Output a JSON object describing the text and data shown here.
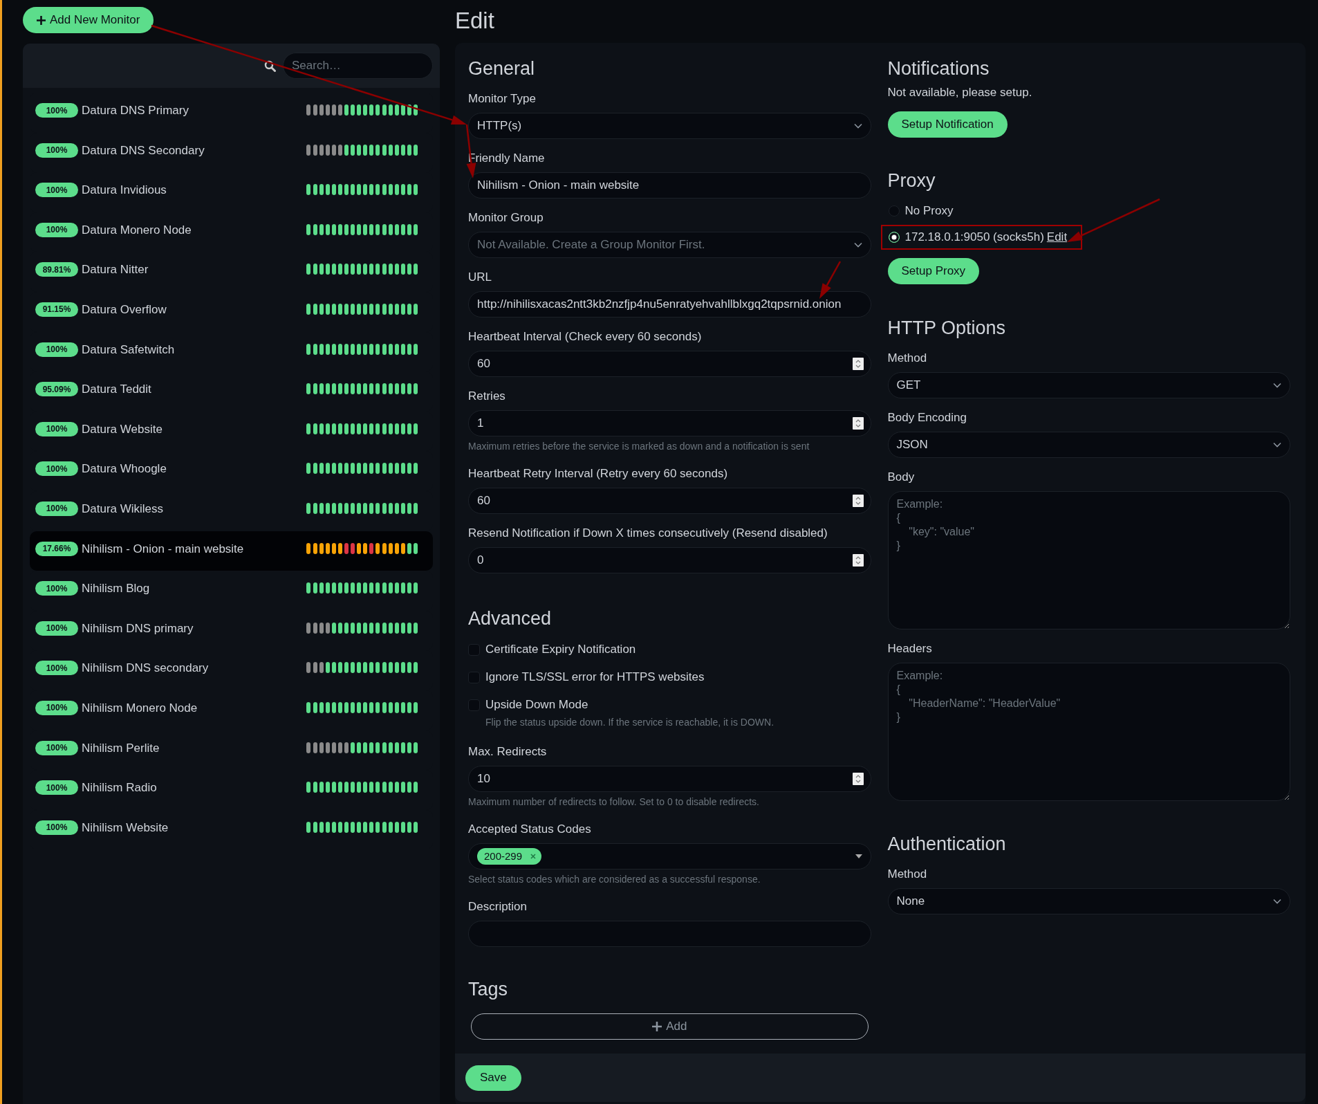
{
  "add_monitor_button": "Add New Monitor",
  "search": {
    "placeholder": "Search…"
  },
  "monitors": [
    {
      "uptime": "100%",
      "name": "Datura DNS Primary",
      "selected": false,
      "beats": [
        {
          "kind": "empty"
        },
        {
          "kind": "empty"
        },
        {
          "kind": "empty"
        },
        {
          "kind": "empty"
        },
        {
          "kind": "empty"
        },
        {
          "kind": "empty"
        },
        {
          "kind": "up"
        },
        {
          "kind": "up"
        },
        {
          "kind": "up"
        },
        {
          "kind": "up"
        },
        {
          "kind": "up"
        },
        {
          "kind": "up"
        },
        {
          "kind": "up"
        },
        {
          "kind": "up"
        },
        {
          "kind": "up"
        },
        {
          "kind": "up"
        },
        {
          "kind": "up"
        },
        {
          "kind": "up"
        }
      ]
    },
    {
      "uptime": "100%",
      "name": "Datura DNS Secondary",
      "selected": false,
      "beats": [
        {
          "kind": "empty"
        },
        {
          "kind": "empty"
        },
        {
          "kind": "empty"
        },
        {
          "kind": "empty"
        },
        {
          "kind": "empty"
        },
        {
          "kind": "empty"
        },
        {
          "kind": "up"
        },
        {
          "kind": "up"
        },
        {
          "kind": "up"
        },
        {
          "kind": "up"
        },
        {
          "kind": "up"
        },
        {
          "kind": "up"
        },
        {
          "kind": "up"
        },
        {
          "kind": "up"
        },
        {
          "kind": "up"
        },
        {
          "kind": "up"
        },
        {
          "kind": "up"
        },
        {
          "kind": "up"
        }
      ]
    },
    {
      "uptime": "100%",
      "name": "Datura Invidious",
      "selected": false,
      "beats": [
        {
          "kind": "up"
        },
        {
          "kind": "up"
        },
        {
          "kind": "up"
        },
        {
          "kind": "up"
        },
        {
          "kind": "up"
        },
        {
          "kind": "up"
        },
        {
          "kind": "up"
        },
        {
          "kind": "up"
        },
        {
          "kind": "up"
        },
        {
          "kind": "up"
        },
        {
          "kind": "up"
        },
        {
          "kind": "up"
        },
        {
          "kind": "up"
        },
        {
          "kind": "up"
        },
        {
          "kind": "up"
        },
        {
          "kind": "up"
        },
        {
          "kind": "up"
        },
        {
          "kind": "up"
        }
      ]
    },
    {
      "uptime": "100%",
      "name": "Datura Monero Node",
      "selected": false,
      "beats": [
        {
          "kind": "up"
        },
        {
          "kind": "up"
        },
        {
          "kind": "up"
        },
        {
          "kind": "up"
        },
        {
          "kind": "up"
        },
        {
          "kind": "up"
        },
        {
          "kind": "up"
        },
        {
          "kind": "up"
        },
        {
          "kind": "up"
        },
        {
          "kind": "up"
        },
        {
          "kind": "up"
        },
        {
          "kind": "up"
        },
        {
          "kind": "up"
        },
        {
          "kind": "up"
        },
        {
          "kind": "up"
        },
        {
          "kind": "up"
        },
        {
          "kind": "up"
        },
        {
          "kind": "up"
        }
      ]
    },
    {
      "uptime": "89.81%",
      "name": "Datura Nitter",
      "selected": false,
      "beats": [
        {
          "kind": "up"
        },
        {
          "kind": "up"
        },
        {
          "kind": "up"
        },
        {
          "kind": "up"
        },
        {
          "kind": "up"
        },
        {
          "kind": "up"
        },
        {
          "kind": "up"
        },
        {
          "kind": "up"
        },
        {
          "kind": "up"
        },
        {
          "kind": "up"
        },
        {
          "kind": "up"
        },
        {
          "kind": "up"
        },
        {
          "kind": "up"
        },
        {
          "kind": "up"
        },
        {
          "kind": "up"
        },
        {
          "kind": "up"
        },
        {
          "kind": "up"
        },
        {
          "kind": "up"
        }
      ]
    },
    {
      "uptime": "91.15%",
      "name": "Datura Overflow",
      "selected": false,
      "beats": [
        {
          "kind": "up"
        },
        {
          "kind": "up"
        },
        {
          "kind": "up"
        },
        {
          "kind": "up"
        },
        {
          "kind": "up"
        },
        {
          "kind": "up"
        },
        {
          "kind": "up"
        },
        {
          "kind": "up"
        },
        {
          "kind": "up"
        },
        {
          "kind": "up"
        },
        {
          "kind": "up"
        },
        {
          "kind": "up"
        },
        {
          "kind": "up"
        },
        {
          "kind": "up"
        },
        {
          "kind": "up"
        },
        {
          "kind": "up"
        },
        {
          "kind": "up"
        },
        {
          "kind": "up"
        }
      ]
    },
    {
      "uptime": "100%",
      "name": "Datura Safetwitch",
      "selected": false,
      "beats": [
        {
          "kind": "up"
        },
        {
          "kind": "up"
        },
        {
          "kind": "up"
        },
        {
          "kind": "up"
        },
        {
          "kind": "up"
        },
        {
          "kind": "up"
        },
        {
          "kind": "up"
        },
        {
          "kind": "up"
        },
        {
          "kind": "up"
        },
        {
          "kind": "up"
        },
        {
          "kind": "up"
        },
        {
          "kind": "up"
        },
        {
          "kind": "up"
        },
        {
          "kind": "up"
        },
        {
          "kind": "up"
        },
        {
          "kind": "up"
        },
        {
          "kind": "up"
        },
        {
          "kind": "up"
        }
      ]
    },
    {
      "uptime": "95.09%",
      "name": "Datura Teddit",
      "selected": false,
      "beats": [
        {
          "kind": "up"
        },
        {
          "kind": "up"
        },
        {
          "kind": "up"
        },
        {
          "kind": "up"
        },
        {
          "kind": "up"
        },
        {
          "kind": "up"
        },
        {
          "kind": "up"
        },
        {
          "kind": "up"
        },
        {
          "kind": "up"
        },
        {
          "kind": "up"
        },
        {
          "kind": "up"
        },
        {
          "kind": "up"
        },
        {
          "kind": "up"
        },
        {
          "kind": "up"
        },
        {
          "kind": "up"
        },
        {
          "kind": "up"
        },
        {
          "kind": "up"
        },
        {
          "kind": "up"
        }
      ]
    },
    {
      "uptime": "100%",
      "name": "Datura Website",
      "selected": false,
      "beats": [
        {
          "kind": "up"
        },
        {
          "kind": "up"
        },
        {
          "kind": "up"
        },
        {
          "kind": "up"
        },
        {
          "kind": "up"
        },
        {
          "kind": "up"
        },
        {
          "kind": "up"
        },
        {
          "kind": "up"
        },
        {
          "kind": "up"
        },
        {
          "kind": "up"
        },
        {
          "kind": "up"
        },
        {
          "kind": "up"
        },
        {
          "kind": "up"
        },
        {
          "kind": "up"
        },
        {
          "kind": "up"
        },
        {
          "kind": "up"
        },
        {
          "kind": "up"
        },
        {
          "kind": "up"
        }
      ]
    },
    {
      "uptime": "100%",
      "name": "Datura Whoogle",
      "selected": false,
      "beats": [
        {
          "kind": "up"
        },
        {
          "kind": "up"
        },
        {
          "kind": "up"
        },
        {
          "kind": "up"
        },
        {
          "kind": "up"
        },
        {
          "kind": "up"
        },
        {
          "kind": "up"
        },
        {
          "kind": "up"
        },
        {
          "kind": "up"
        },
        {
          "kind": "up"
        },
        {
          "kind": "up"
        },
        {
          "kind": "up"
        },
        {
          "kind": "up"
        },
        {
          "kind": "up"
        },
        {
          "kind": "up"
        },
        {
          "kind": "up"
        },
        {
          "kind": "up"
        },
        {
          "kind": "up"
        }
      ]
    },
    {
      "uptime": "100%",
      "name": "Datura Wikiless",
      "selected": false,
      "beats": [
        {
          "kind": "up"
        },
        {
          "kind": "up"
        },
        {
          "kind": "up"
        },
        {
          "kind": "up"
        },
        {
          "kind": "up"
        },
        {
          "kind": "up"
        },
        {
          "kind": "up"
        },
        {
          "kind": "up"
        },
        {
          "kind": "up"
        },
        {
          "kind": "up"
        },
        {
          "kind": "up"
        },
        {
          "kind": "up"
        },
        {
          "kind": "up"
        },
        {
          "kind": "up"
        },
        {
          "kind": "up"
        },
        {
          "kind": "up"
        },
        {
          "kind": "up"
        },
        {
          "kind": "up"
        }
      ]
    },
    {
      "uptime": "17.66%",
      "name": "Nihilism - Onion - main website",
      "selected": true,
      "beats": [
        {
          "kind": "pending"
        },
        {
          "kind": "pending"
        },
        {
          "kind": "pending"
        },
        {
          "kind": "pending"
        },
        {
          "kind": "pending"
        },
        {
          "kind": "pending"
        },
        {
          "kind": "down"
        },
        {
          "kind": "down"
        },
        {
          "kind": "pending"
        },
        {
          "kind": "pending"
        },
        {
          "kind": "down"
        },
        {
          "kind": "pending"
        },
        {
          "kind": "pending"
        },
        {
          "kind": "pending"
        },
        {
          "kind": "pending"
        },
        {
          "kind": "pending"
        },
        {
          "kind": "up"
        },
        {
          "kind": "up"
        }
      ]
    },
    {
      "uptime": "100%",
      "name": "Nihilism Blog",
      "selected": false,
      "beats": [
        {
          "kind": "up"
        },
        {
          "kind": "up"
        },
        {
          "kind": "up"
        },
        {
          "kind": "up"
        },
        {
          "kind": "up"
        },
        {
          "kind": "up"
        },
        {
          "kind": "up"
        },
        {
          "kind": "up"
        },
        {
          "kind": "up"
        },
        {
          "kind": "up"
        },
        {
          "kind": "up"
        },
        {
          "kind": "up"
        },
        {
          "kind": "up"
        },
        {
          "kind": "up"
        },
        {
          "kind": "up"
        },
        {
          "kind": "up"
        },
        {
          "kind": "up"
        },
        {
          "kind": "up"
        }
      ]
    },
    {
      "uptime": "100%",
      "name": "Nihilism DNS primary",
      "selected": false,
      "beats": [
        {
          "kind": "empty"
        },
        {
          "kind": "empty"
        },
        {
          "kind": "empty"
        },
        {
          "kind": "empty"
        },
        {
          "kind": "up"
        },
        {
          "kind": "up"
        },
        {
          "kind": "up"
        },
        {
          "kind": "up"
        },
        {
          "kind": "up"
        },
        {
          "kind": "up"
        },
        {
          "kind": "up"
        },
        {
          "kind": "up"
        },
        {
          "kind": "up"
        },
        {
          "kind": "up"
        },
        {
          "kind": "up"
        },
        {
          "kind": "up"
        },
        {
          "kind": "up"
        },
        {
          "kind": "up"
        }
      ]
    },
    {
      "uptime": "100%",
      "name": "Nihilism DNS secondary",
      "selected": false,
      "beats": [
        {
          "kind": "empty"
        },
        {
          "kind": "empty"
        },
        {
          "kind": "empty"
        },
        {
          "kind": "up"
        },
        {
          "kind": "up"
        },
        {
          "kind": "up"
        },
        {
          "kind": "up"
        },
        {
          "kind": "up"
        },
        {
          "kind": "up"
        },
        {
          "kind": "up"
        },
        {
          "kind": "up"
        },
        {
          "kind": "up"
        },
        {
          "kind": "up"
        },
        {
          "kind": "up"
        },
        {
          "kind": "up"
        },
        {
          "kind": "up"
        },
        {
          "kind": "up"
        },
        {
          "kind": "up"
        }
      ]
    },
    {
      "uptime": "100%",
      "name": "Nihilism Monero Node",
      "selected": false,
      "beats": [
        {
          "kind": "up"
        },
        {
          "kind": "up"
        },
        {
          "kind": "up"
        },
        {
          "kind": "up"
        },
        {
          "kind": "up"
        },
        {
          "kind": "up"
        },
        {
          "kind": "up"
        },
        {
          "kind": "up"
        },
        {
          "kind": "up"
        },
        {
          "kind": "up"
        },
        {
          "kind": "up"
        },
        {
          "kind": "up"
        },
        {
          "kind": "up"
        },
        {
          "kind": "up"
        },
        {
          "kind": "up"
        },
        {
          "kind": "up"
        },
        {
          "kind": "up"
        },
        {
          "kind": "up"
        }
      ]
    },
    {
      "uptime": "100%",
      "name": "Nihilism Perlite",
      "selected": false,
      "beats": [
        {
          "kind": "empty"
        },
        {
          "kind": "empty"
        },
        {
          "kind": "empty"
        },
        {
          "kind": "empty"
        },
        {
          "kind": "empty"
        },
        {
          "kind": "empty"
        },
        {
          "kind": "empty"
        },
        {
          "kind": "up"
        },
        {
          "kind": "up"
        },
        {
          "kind": "up"
        },
        {
          "kind": "up"
        },
        {
          "kind": "up"
        },
        {
          "kind": "up"
        },
        {
          "kind": "up"
        },
        {
          "kind": "up"
        },
        {
          "kind": "up"
        },
        {
          "kind": "up"
        },
        {
          "kind": "up"
        }
      ]
    },
    {
      "uptime": "100%",
      "name": "Nihilism Radio",
      "selected": false,
      "beats": [
        {
          "kind": "up"
        },
        {
          "kind": "up"
        },
        {
          "kind": "up"
        },
        {
          "kind": "up"
        },
        {
          "kind": "up"
        },
        {
          "kind": "up"
        },
        {
          "kind": "up"
        },
        {
          "kind": "up"
        },
        {
          "kind": "up"
        },
        {
          "kind": "up"
        },
        {
          "kind": "up"
        },
        {
          "kind": "up"
        },
        {
          "kind": "up"
        },
        {
          "kind": "up"
        },
        {
          "kind": "up"
        },
        {
          "kind": "up"
        },
        {
          "kind": "up"
        },
        {
          "kind": "up"
        }
      ]
    },
    {
      "uptime": "100%",
      "name": "Nihilism Website",
      "selected": false,
      "beats": [
        {
          "kind": "up"
        },
        {
          "kind": "up"
        },
        {
          "kind": "up"
        },
        {
          "kind": "up"
        },
        {
          "kind": "up"
        },
        {
          "kind": "up"
        },
        {
          "kind": "up"
        },
        {
          "kind": "up"
        },
        {
          "kind": "up"
        },
        {
          "kind": "up"
        },
        {
          "kind": "up"
        },
        {
          "kind": "up"
        },
        {
          "kind": "up"
        },
        {
          "kind": "up"
        },
        {
          "kind": "up"
        },
        {
          "kind": "up"
        },
        {
          "kind": "up"
        },
        {
          "kind": "up"
        }
      ]
    }
  ],
  "page_title": "Edit",
  "general": {
    "title": "General",
    "fields": [
      {
        "kind": "select",
        "label": "Monitor Type",
        "value": "HTTP(s)",
        "disabled": false
      },
      {
        "kind": "text",
        "label": "Friendly Name",
        "value": "Nihilism - Onion - main website",
        "disabled": false
      },
      {
        "kind": "select",
        "label": "Monitor Group",
        "value": "Not Available. Create a Group Monitor First.",
        "disabled": true
      },
      {
        "kind": "text",
        "label": "URL",
        "value": "http://nihilisxacas2ntt3kb2nzfjp4nu5enratyehvahllblxgq2tqpsrnid.onion",
        "disabled": false
      },
      {
        "kind": "number",
        "label": "Heartbeat Interval (Check every 60 seconds)",
        "value": "60",
        "disabled": false
      },
      {
        "kind": "number",
        "label": "Retries",
        "value": "1",
        "hint": "Maximum retries before the service is marked as down and a notification is sent",
        "disabled": false
      },
      {
        "kind": "number",
        "label": "Heartbeat Retry Interval (Retry every 60 seconds)",
        "value": "60",
        "disabled": false
      },
      {
        "kind": "number",
        "label": "Resend Notification if Down X times consecutively (Resend disabled)",
        "value": "0",
        "disabled": false
      }
    ]
  },
  "advanced": {
    "title": "Advanced",
    "checkboxes": [
      {
        "label": "Certificate Expiry Notification",
        "checked": false
      },
      {
        "label": "Ignore TLS/SSL error for HTTPS websites",
        "checked": false
      },
      {
        "label": "Upside Down Mode",
        "checked": false,
        "hint": "Flip the status upside down. If the service is reachable, it is DOWN."
      }
    ],
    "fields": [
      {
        "kind": "number",
        "label": "Max. Redirects",
        "value": "10",
        "hint": "Maximum number of redirects to follow. Set to 0 to disable redirects.",
        "disabled": false
      },
      {
        "kind": "tags",
        "label": "Accepted Status Codes",
        "tags": [
          "200-299"
        ],
        "hint": "Select status codes which are considered as a successful response.",
        "disabled": false
      },
      {
        "kind": "text",
        "label": "Description",
        "disabled": false
      }
    ]
  },
  "tags": {
    "title": "Tags",
    "add_button": "Add"
  },
  "save_button": "Save",
  "notifications": {
    "title": "Notifications",
    "message": "Not available, please setup.",
    "button": "Setup Notification"
  },
  "proxy": {
    "title": "Proxy",
    "options": [
      {
        "label": "No Proxy",
        "selected": false
      },
      {
        "label": "172.18.0.1:9050 (socks5h)",
        "edit_link": "Edit",
        "selected": true
      }
    ],
    "button": "Setup Proxy"
  },
  "http_options": {
    "title": "HTTP Options",
    "fields": [
      {
        "kind": "select",
        "label": "Method",
        "value": "GET",
        "disabled": false
      },
      {
        "kind": "select",
        "label": "Body Encoding",
        "value": "JSON",
        "disabled": false
      },
      {
        "kind": "textarea",
        "label": "Body",
        "placeholder": "Example:\n{\n    \"key\": \"value\"\n}",
        "disabled": false
      },
      {
        "kind": "textarea",
        "label": "Headers",
        "placeholder": "Example:\n{\n    \"HeaderName\": \"HeaderValue\"\n}",
        "disabled": false
      }
    ]
  },
  "authentication": {
    "title": "Authentication",
    "fields": [
      {
        "kind": "select",
        "label": "Method",
        "value": "None",
        "disabled": false
      }
    ]
  }
}
